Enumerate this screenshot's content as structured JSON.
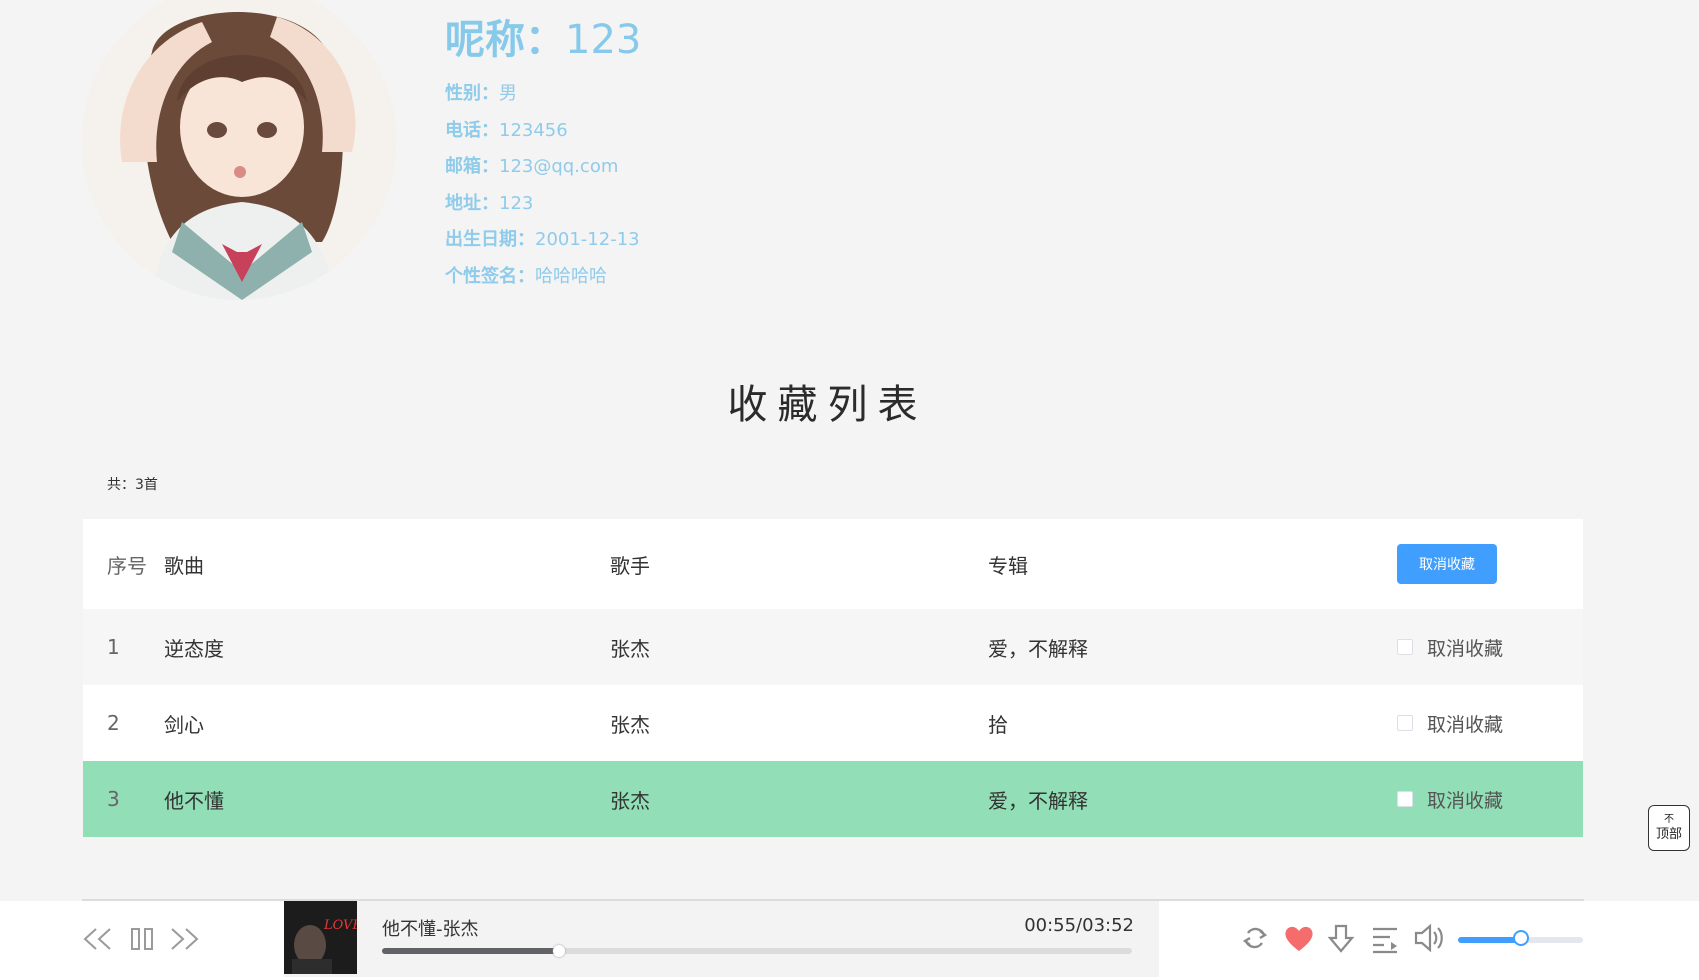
{
  "profile": {
    "nickname_label": "呢称：",
    "nickname_value": "123",
    "gender_label": "性别：",
    "gender_value": "男",
    "phone_label": "电话：",
    "phone_value": "123456",
    "email_label": "邮箱：",
    "email_value": "123@qq.com",
    "address_label": "地址：",
    "address_value": "123",
    "birthday_label": "出生日期：",
    "birthday_value": "2001-12-13",
    "signature_label": "个性签名：",
    "signature_value": "哈哈哈哈"
  },
  "collection": {
    "title": "收藏列表",
    "total": "共：3首",
    "headers": {
      "index": "序号",
      "song": "歌曲",
      "singer": "歌手",
      "album": "专辑",
      "action": "取消收藏"
    },
    "rows": [
      {
        "index": "1",
        "song": "逆态度",
        "singer": "张杰",
        "album": "爱，不解释",
        "action": "取消收藏"
      },
      {
        "index": "2",
        "song": "剑心",
        "singer": "张杰",
        "album": "拾",
        "action": "取消收藏"
      },
      {
        "index": "3",
        "song": "他不懂",
        "singer": "张杰",
        "album": "爱，不解释",
        "action": "取消收藏"
      }
    ]
  },
  "totop": {
    "arrow": "不",
    "label": "顶部"
  },
  "player": {
    "cover_text": "LOVE",
    "now_playing": "他不懂-张杰",
    "time": "00:55/03:52",
    "progress": 0.236,
    "volume": 0.5,
    "like_color": "#f56c6c",
    "accent_color": "#409eff"
  }
}
